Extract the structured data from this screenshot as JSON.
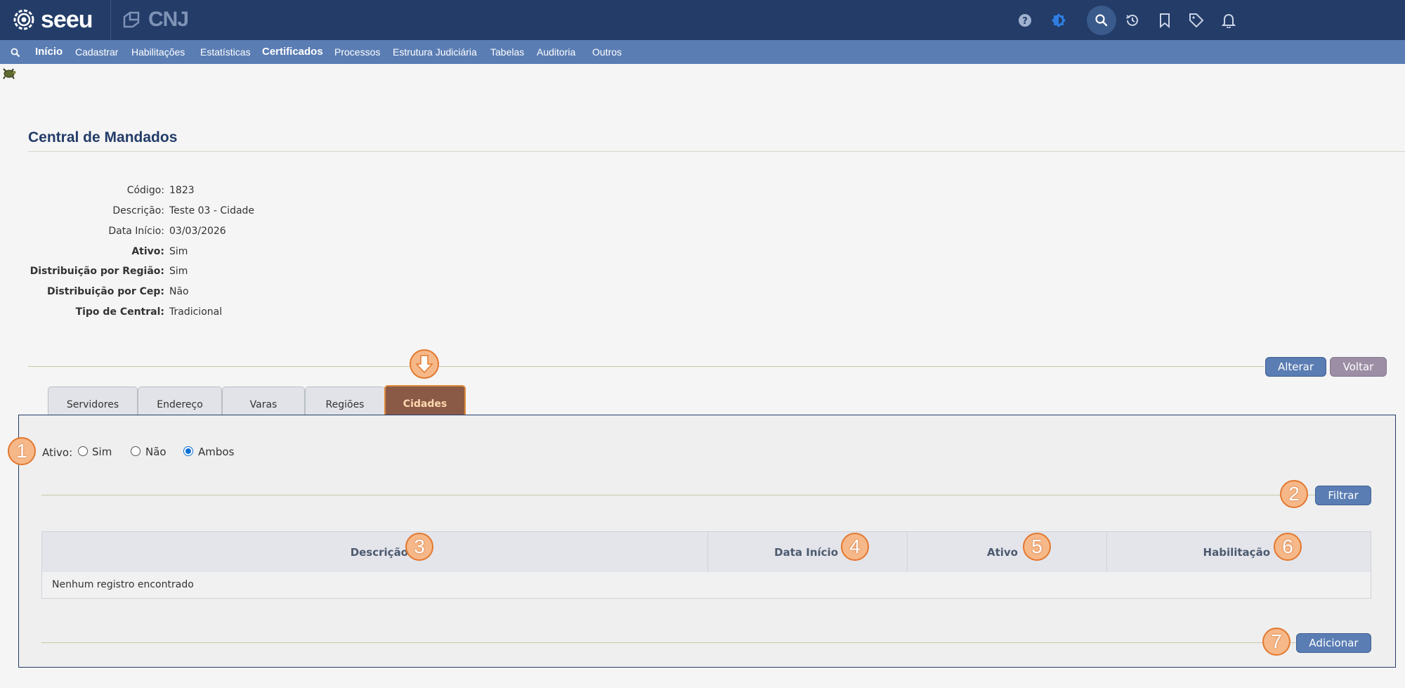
{
  "header": {
    "logo_text": "seeu",
    "partner_logo_text": "CNJ",
    "icons": [
      "help-icon",
      "theme-icon",
      "search-icon",
      "history-icon",
      "bookmark-icon",
      "tag-icon",
      "bell-icon"
    ]
  },
  "menu": {
    "items": [
      "Início",
      "Cadastrar",
      "Habilitações",
      "Estatísticas",
      "Certificados",
      "Processos",
      "Estrutura Judiciária",
      "Tabelas",
      "Auditoria",
      "Outros"
    ]
  },
  "page": {
    "title": "Central de Mandados"
  },
  "details": {
    "codigo_label": "Código:",
    "codigo_value": "1823",
    "descricao_label": "Descrição:",
    "descricao_value": "Teste 03 - Cidade",
    "data_inicio_label": "Data Início:",
    "data_inicio_value": "03/03/2026",
    "ativo_label": "Ativo:",
    "ativo_value": "Sim",
    "dist_regiao_label": "Distribuição por Região:",
    "dist_regiao_value": "Sim",
    "dist_cep_label": "Distribuição por Cep:",
    "dist_cep_value": "Não",
    "tipo_label": "Tipo de Central:",
    "tipo_value": "Tradicional"
  },
  "actions": {
    "alterar": "Alterar",
    "voltar": "Voltar"
  },
  "tabs": [
    "Servidores",
    "Endereço",
    "Varas",
    "Regiões",
    "Cidades"
  ],
  "active_tab": "Cidades",
  "filter": {
    "label": "Ativo:",
    "options": [
      "Sim",
      "Não",
      "Ambos"
    ],
    "selected": "Ambos",
    "button": "Filtrar"
  },
  "table": {
    "columns": [
      "Descrição",
      "Data Início",
      "Ativo",
      "Habilitação"
    ],
    "empty_message": "Nenhum registro encontrado"
  },
  "add_button": "Adicionar",
  "annotations": [
    "1",
    "2",
    "3",
    "4",
    "5",
    "6",
    "7"
  ],
  "colors": {
    "topbar": "#233c68",
    "menubar": "#5a7db3",
    "active_tab": "#8a5a46",
    "badge": "#f6b888"
  }
}
